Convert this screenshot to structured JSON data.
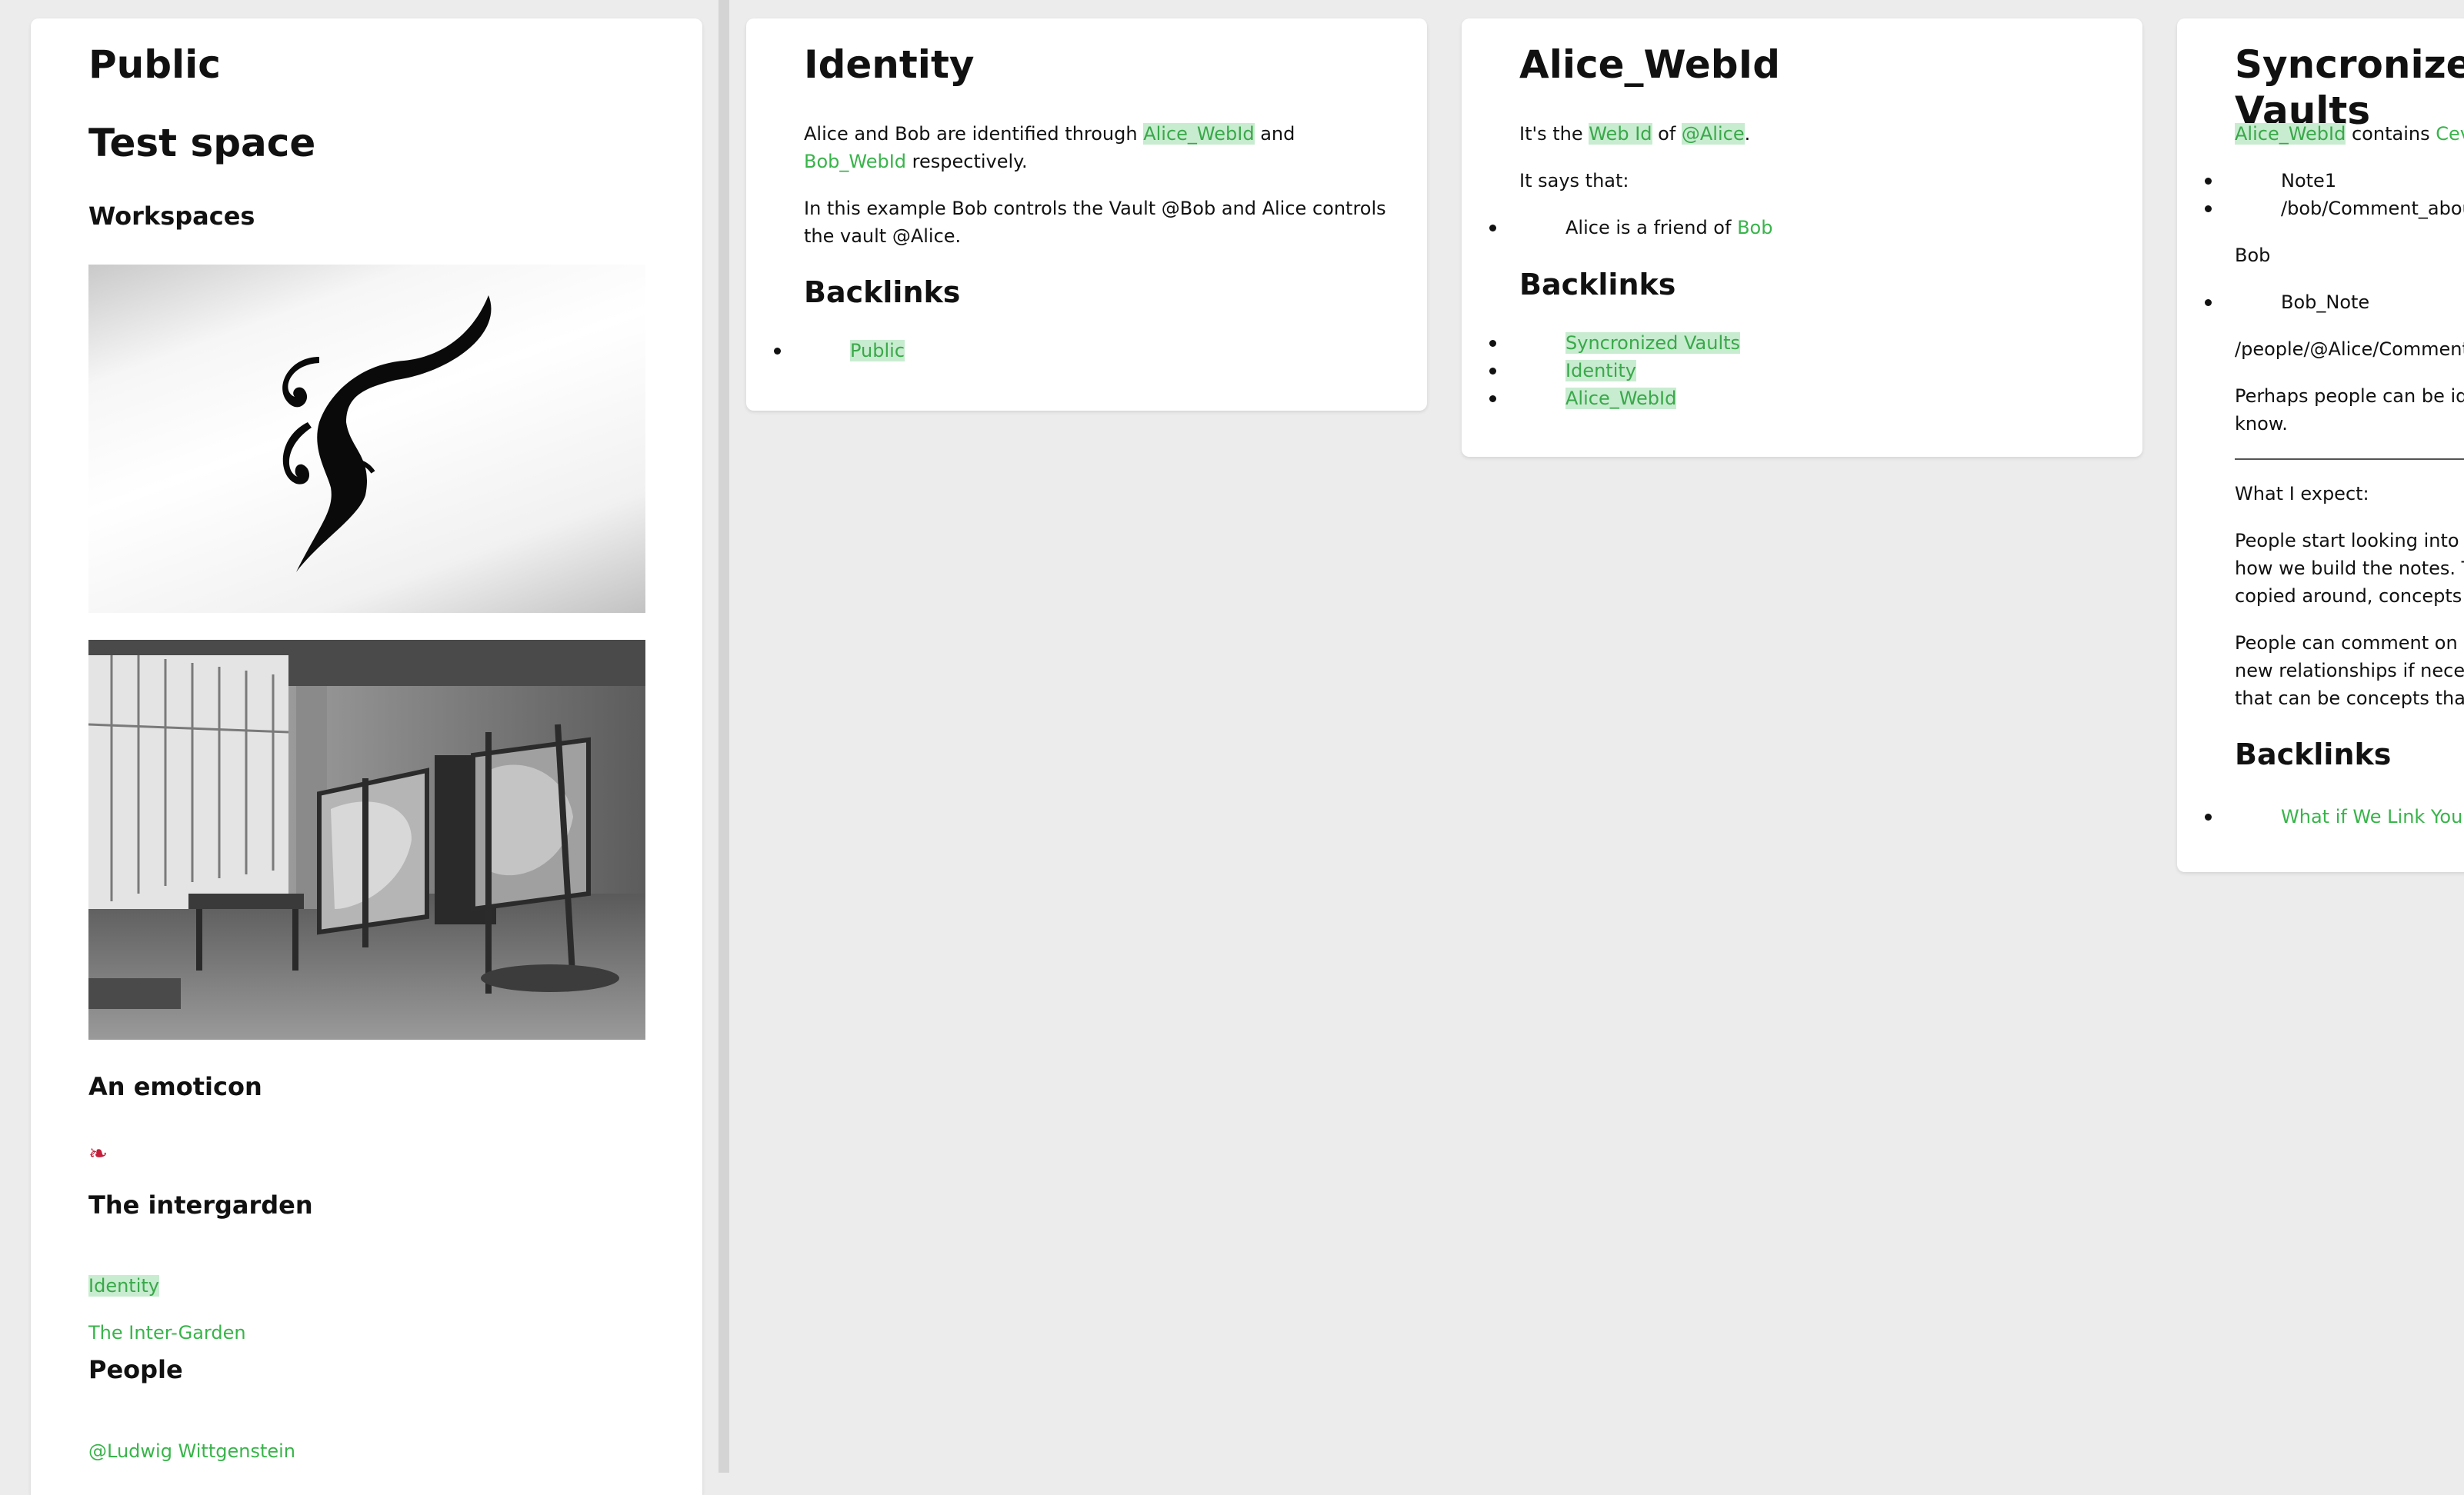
{
  "public": {
    "title": "Public",
    "subtitle": "Test space",
    "workspaces_heading": "Workspaces",
    "emoticon_heading": "An emoticon",
    "emoticon_glyph": "❧",
    "intergarden_heading": "The intergarden",
    "intergarden_link_identity": "Identity",
    "intergarden_link_garden": "The Inter-Garden",
    "people_heading": "People",
    "people_link": "@Ludwig Wittgenstein"
  },
  "identity": {
    "title": "Identity",
    "p1_a": "Alice and Bob are identified through ",
    "p1_link1": "Alice_WebId",
    "p1_b": " and",
    "p1_link2": "Bob_WebId",
    "p1_c": " respectively.",
    "p2_line1": "In this example Bob controls the Vault @Bob and Alice controls",
    "p2_line2": "the vault @Alice.",
    "backlinks_heading": "Backlinks",
    "backlinks": [
      "Public"
    ]
  },
  "webid": {
    "title": "Alice_WebId",
    "p1_a": "It's the ",
    "p1_link1": "Web Id",
    "p1_b": " of ",
    "p1_link2": "@Alice",
    "p1_c": ".",
    "p2": "It says that:",
    "fact_a": "Alice is a friend of ",
    "fact_link": "Bob",
    "backlinks_heading": "Backlinks",
    "backlinks": [
      "Syncronized Vaults",
      "Identity",
      "Alice_WebId"
    ]
  },
  "sync": {
    "title": "Syncronized Vaults",
    "p1_link1": "Alice_WebId",
    "p1_b": " contains ",
    "p1_link2": "Cev",
    "list1": [
      "Note1",
      "/bob/Comment_about"
    ],
    "bob_label": "Bob",
    "list2": [
      "Bob_Note"
    ],
    "path": "/people/@Alice/Comment_",
    "perhaps_line1": "Perhaps people can be ide",
    "perhaps_line2": "know.",
    "expect": "What I expect:",
    "para1_line1": "People start looking into e",
    "para1_line2": "how we build the notes. Th",
    "para1_line3": "copied around, concepts s",
    "para2_line1": "People can comment on co",
    "para2_line2": "new relationships if necess",
    "para2_line3": "that can be concepts that c",
    "backlinks_heading": "Backlinks",
    "backlinks": [
      "What if We Link Your"
    ]
  },
  "colors": {
    "link": "#38b44a",
    "highlight_bg": "#c8ecd0",
    "page_bg": "#ececec",
    "card_bg": "#ffffff"
  }
}
